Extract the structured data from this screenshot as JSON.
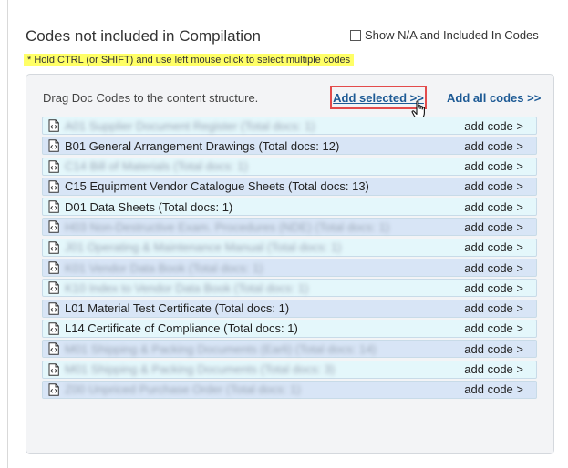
{
  "header": {
    "title": "Codes not included in Compilation",
    "show_na_label": "Show N/A and Included In Codes",
    "hint": "* Hold CTRL (or SHIFT) and use left mouse click to select multiple codes"
  },
  "panel": {
    "drag_label": "Drag Doc Codes to the content structure.",
    "add_selected_label": "Add selected >>",
    "add_all_label": "Add all codes >>"
  },
  "rows": [
    {
      "label": "A01 Supplier Document Register (Total docs: 1)",
      "blurred": true,
      "add": "add code >"
    },
    {
      "label": "B01 General Arrangement Drawings (Total docs: 12)",
      "blurred": false,
      "add": "add code >"
    },
    {
      "label": "C14 Bill of Materials (Total docs: 1)",
      "blurred": true,
      "add": "add code >"
    },
    {
      "label": "C15 Equipment Vendor Catalogue Sheets (Total docs: 13)",
      "blurred": false,
      "add": "add code >"
    },
    {
      "label": "D01 Data Sheets (Total docs: 1)",
      "blurred": false,
      "add": "add code >"
    },
    {
      "label": "H03 Non-Destructive Exam. Procedures (NDE) (Total docs: 1)",
      "blurred": true,
      "add": "add code >"
    },
    {
      "label": "J01 Operating & Maintenance Manual (Total docs: 1)",
      "blurred": true,
      "add": "add code >"
    },
    {
      "label": "K01 Vendor Data Book (Total docs: 1)",
      "blurred": true,
      "add": "add code >"
    },
    {
      "label": "K10 Index to Vendor Data Book (Total docs: 1)",
      "blurred": true,
      "add": "add code >"
    },
    {
      "label": "L01 Material Test Certificate (Total docs: 1)",
      "blurred": false,
      "add": "add code >"
    },
    {
      "label": "L14 Certificate of Compliance (Total docs: 1)",
      "blurred": false,
      "add": "add code >"
    },
    {
      "label": "M01 Shipping & Packing Documents (Earli) (Total docs: 14)",
      "blurred": true,
      "add": "add code >"
    },
    {
      "label": "M01 Shipping & Packing Documents (Total docs: 3)",
      "blurred": true,
      "add": "add code >"
    },
    {
      "label": "Z00 Unpriced Purchase Order (Total docs: 1)",
      "blurred": true,
      "add": "add code >"
    }
  ],
  "colors": {
    "link": "#1d5a95",
    "highlight": "#e34b4b",
    "row_odd": "#e4f7fb",
    "row_even": "#d8e5f6",
    "hint_bg": "#ffff66"
  },
  "icons": {
    "row_icon": "xml-document-icon",
    "cursor": "hand-pointer-icon"
  }
}
